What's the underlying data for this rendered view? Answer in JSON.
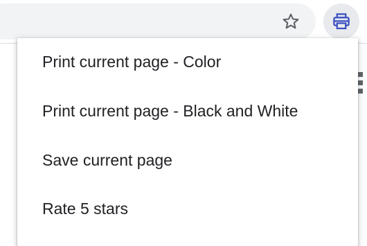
{
  "toolbar": {
    "bookmark_icon": "star-outline-icon",
    "extension_icon": "printer-icon",
    "extension_color": "#3c4ec2"
  },
  "menu": {
    "items": [
      {
        "label": "Print current page - Color"
      },
      {
        "label": "Print current page - Black and White"
      },
      {
        "label": "Save current page"
      },
      {
        "label": "Rate 5 stars"
      }
    ]
  }
}
